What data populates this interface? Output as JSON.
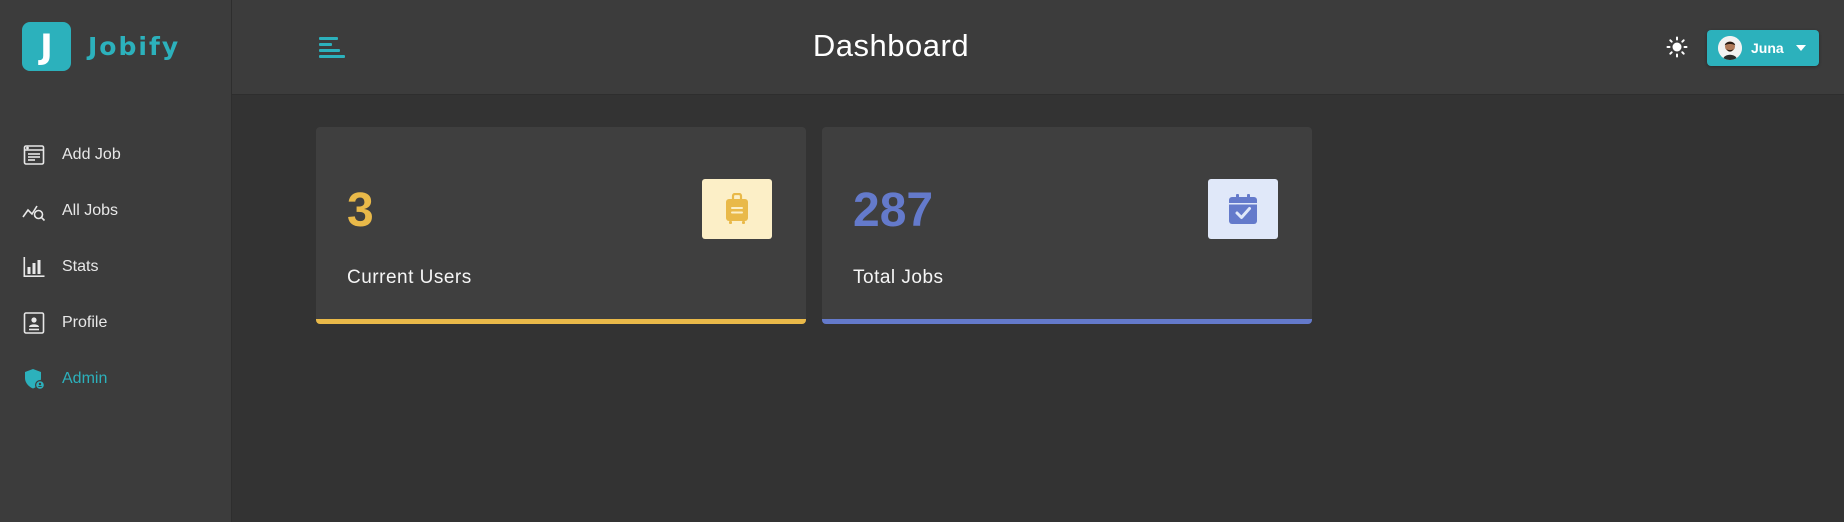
{
  "app": {
    "logo_letter": "J",
    "name": "Jobify"
  },
  "header": {
    "title": "Dashboard",
    "user_name": "Juna"
  },
  "sidebar": {
    "items": [
      {
        "label": "Add Job",
        "icon": "add-job-icon",
        "active": false
      },
      {
        "label": "All Jobs",
        "icon": "all-jobs-icon",
        "active": false
      },
      {
        "label": "Stats",
        "icon": "stats-icon",
        "active": false
      },
      {
        "label": "Profile",
        "icon": "profile-icon",
        "active": false
      },
      {
        "label": "Admin",
        "icon": "admin-shield-icon",
        "active": true
      }
    ]
  },
  "stats": [
    {
      "count": "3",
      "label": "Current Users",
      "icon": "suitcase-icon",
      "color": "#e9b949",
      "bg": "#fcefc7"
    },
    {
      "count": "287",
      "label": "Total Jobs",
      "icon": "calendar-check-icon",
      "color": "#647acb",
      "bg": "#e0e8f9"
    }
  ],
  "colors": {
    "accent": "#2cb1bc",
    "background": "#333333",
    "panel": "#3c3c3c"
  }
}
